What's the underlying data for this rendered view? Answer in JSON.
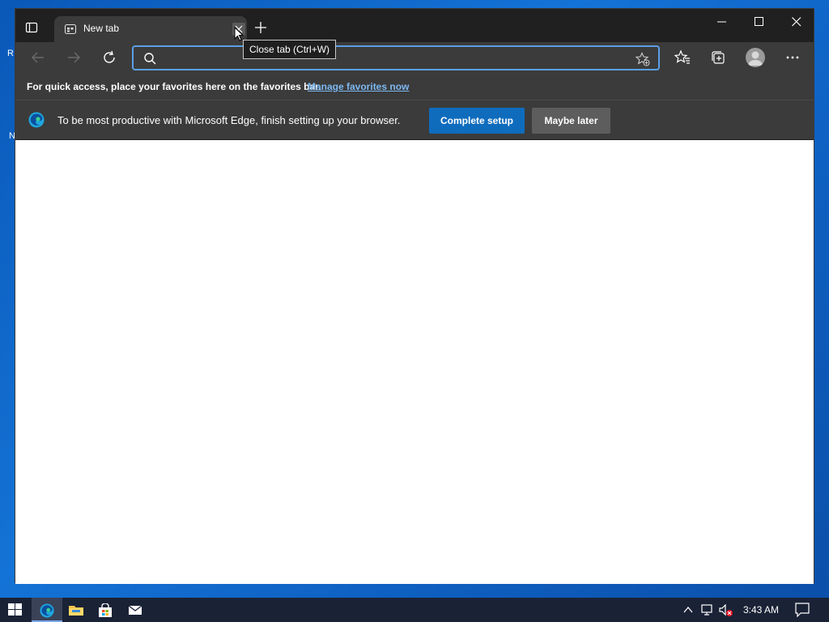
{
  "desktop": {
    "fragment_r": "R",
    "fragment_n": "N"
  },
  "tab": {
    "title": "New tab",
    "close_tooltip": "Close tab (Ctrl+W)"
  },
  "address": {
    "value": "",
    "placeholder": ""
  },
  "favorites_bar": {
    "message": "For quick access, place your favorites here on the favorites bar.",
    "link": "Manage favorites now"
  },
  "infobar": {
    "message": "To be most productive with Microsoft Edge, finish setting up your browser.",
    "primary_button": "Complete setup",
    "secondary_button": "Maybe later"
  },
  "taskbar": {
    "time": "3:43 AM"
  },
  "colors": {
    "accent": "#0f6cbd",
    "link": "#7cb8f2",
    "titlebar": "#202020",
    "toolbar": "#3b3b3b"
  }
}
